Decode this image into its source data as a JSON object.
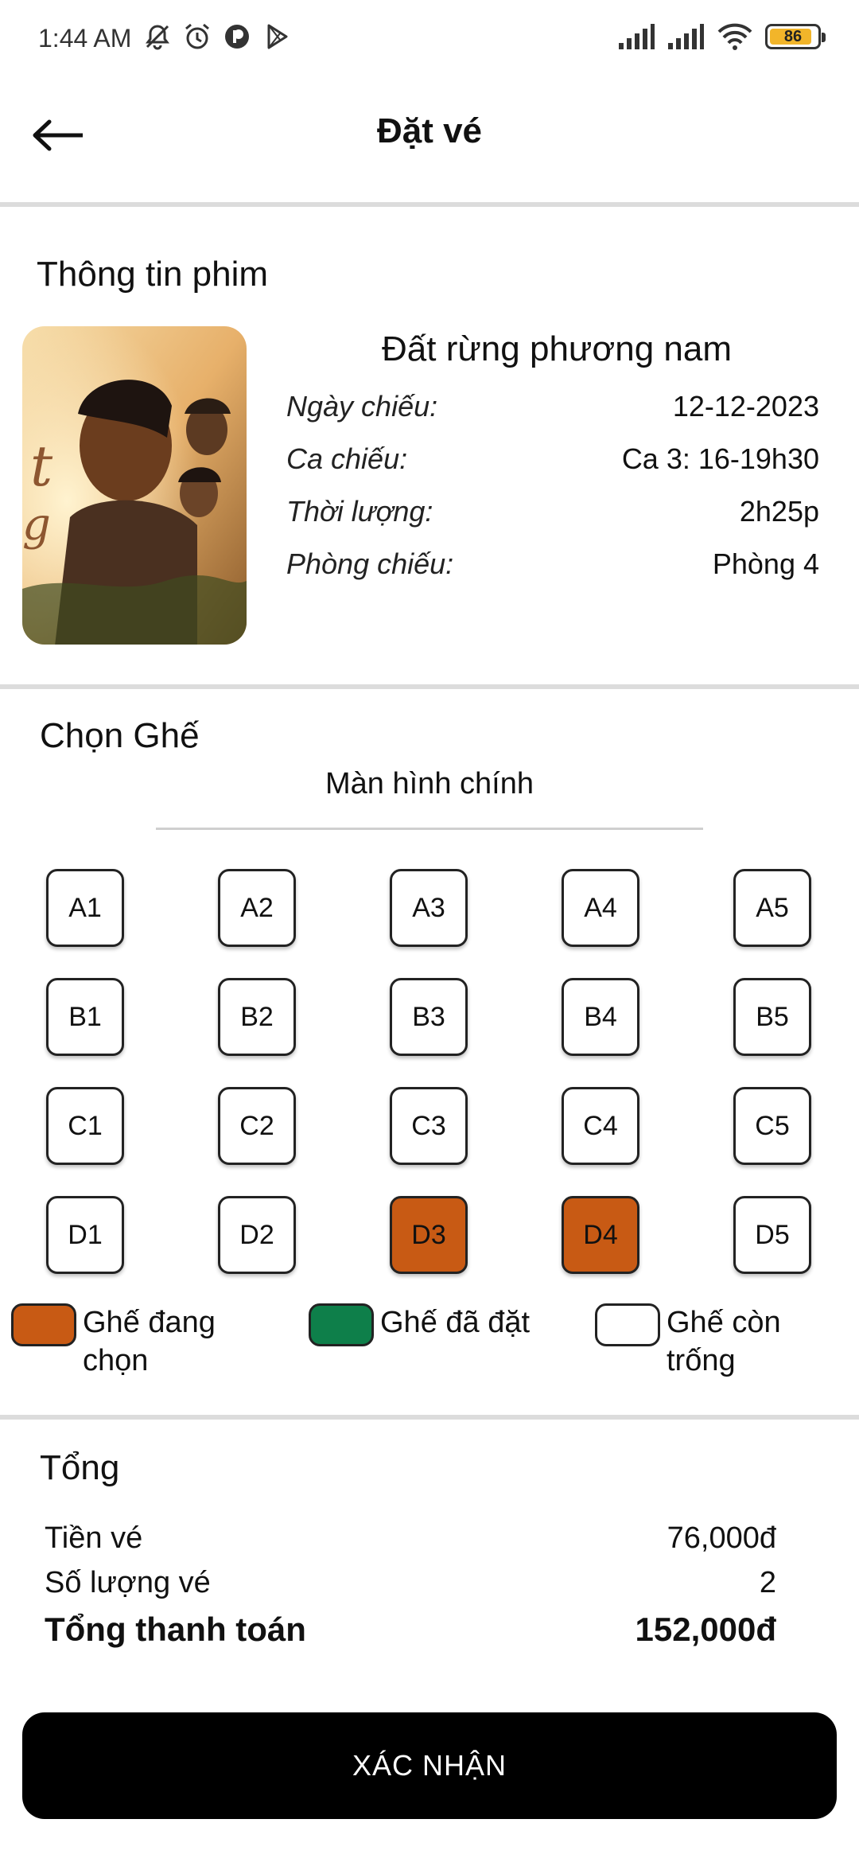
{
  "status_bar": {
    "time": "1:44 AM",
    "battery": "86",
    "left_icons": [
      "bell-off-icon",
      "alarm-icon",
      "app-icon",
      "play-store-icon"
    ],
    "right_icons": [
      "signal-icon",
      "signal-icon",
      "wifi-icon",
      "battery-icon"
    ]
  },
  "header": {
    "title": "Đặt vé",
    "back_icon": "arrow-left-icon"
  },
  "movie_info": {
    "section_title": "Thông tin phim",
    "name": "Đất rừng phương nam",
    "rows": [
      {
        "label": "Ngày chiếu:",
        "value": "12-12-2023"
      },
      {
        "label": "Ca chiếu:",
        "value": "Ca 3: 16-19h30"
      },
      {
        "label": "Thời lượng:",
        "value": "2h25p"
      },
      {
        "label": "Phòng chiếu:",
        "value": "Phòng 4"
      }
    ]
  },
  "seat_selection": {
    "section_title": "Chọn Ghế",
    "screen_label": "Màn hình chính",
    "rows": [
      [
        {
          "id": "A1",
          "state": "available"
        },
        {
          "id": "A2",
          "state": "available"
        },
        {
          "id": "A3",
          "state": "available"
        },
        {
          "id": "A4",
          "state": "available"
        },
        {
          "id": "A5",
          "state": "available"
        }
      ],
      [
        {
          "id": "B1",
          "state": "available"
        },
        {
          "id": "B2",
          "state": "available"
        },
        {
          "id": "B3",
          "state": "available"
        },
        {
          "id": "B4",
          "state": "available"
        },
        {
          "id": "B5",
          "state": "available"
        }
      ],
      [
        {
          "id": "C1",
          "state": "available"
        },
        {
          "id": "C2",
          "state": "available"
        },
        {
          "id": "C3",
          "state": "available"
        },
        {
          "id": "C4",
          "state": "available"
        },
        {
          "id": "C5",
          "state": "available"
        }
      ],
      [
        {
          "id": "D1",
          "state": "available"
        },
        {
          "id": "D2",
          "state": "available"
        },
        {
          "id": "D3",
          "state": "selected"
        },
        {
          "id": "D4",
          "state": "selected"
        },
        {
          "id": "D5",
          "state": "available"
        }
      ]
    ],
    "legend": [
      {
        "line1": "Ghế đang",
        "line2": "chọn",
        "color": "#c85a14"
      },
      {
        "line1": "Ghế đã đặt",
        "line2": "",
        "color": "#0e7f4a"
      },
      {
        "line1": "Ghế còn",
        "line2": "trống",
        "color": "#ffffff"
      }
    ]
  },
  "summary": {
    "section_title": "Tổng",
    "ticket_price_label": "Tiền vé",
    "ticket_price_value": "76,000đ",
    "quantity_label": "Số lượng vé",
    "quantity_value": "2",
    "total_label": "Tổng thanh toán",
    "total_value": "152,000đ"
  },
  "confirm_button": {
    "label": "XÁC NHẬN"
  },
  "colors": {
    "selected_seat": "#c85a14",
    "booked_seat": "#0e7f4a",
    "available_seat": "#ffffff",
    "button_bg": "#000000"
  }
}
